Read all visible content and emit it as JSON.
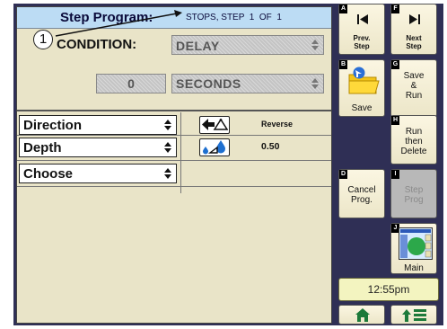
{
  "header": {
    "title": "Step Program:",
    "status": "STOPS, STEP  1  OF  1"
  },
  "callout": {
    "number": "1"
  },
  "condition": {
    "label": "CONDITION:",
    "value": "DELAY",
    "amount": "0",
    "unit": "SECONDS"
  },
  "functions": [
    {
      "label": "Direction",
      "icon": "reverse-direction-icon",
      "value": "Reverse"
    },
    {
      "label": "Depth",
      "icon": "depth-drops-icon",
      "value": "0.50"
    },
    {
      "label": "Choose",
      "icon": "",
      "value": ""
    }
  ],
  "buttons": {
    "prev": {
      "key": "A",
      "label_line1": "Prev.",
      "label_line2": "Step"
    },
    "next": {
      "key": "F",
      "label_line1": "Next",
      "label_line2": "Step"
    },
    "save": {
      "key": "B",
      "label": "Save"
    },
    "save_run": {
      "key": "G",
      "line1": "Save",
      "line2": "&",
      "line3": "Run"
    },
    "run_delete": {
      "key": "H",
      "line1": "Run",
      "line2": "then",
      "line3": "Delete"
    },
    "cancel": {
      "key": "D",
      "line1": "Cancel",
      "line2": "Prog."
    },
    "step_prog": {
      "key": "I",
      "line1": "Step",
      "line2": "Prog"
    },
    "main": {
      "key": "J",
      "label": "Main"
    }
  },
  "clock": "12:55pm",
  "colors": {
    "screen_bg": "#2f2f55",
    "panel_bg": "#e9e4c8",
    "title_bg": "#bcdcf4",
    "clock_bg": "#f3f4c0"
  }
}
